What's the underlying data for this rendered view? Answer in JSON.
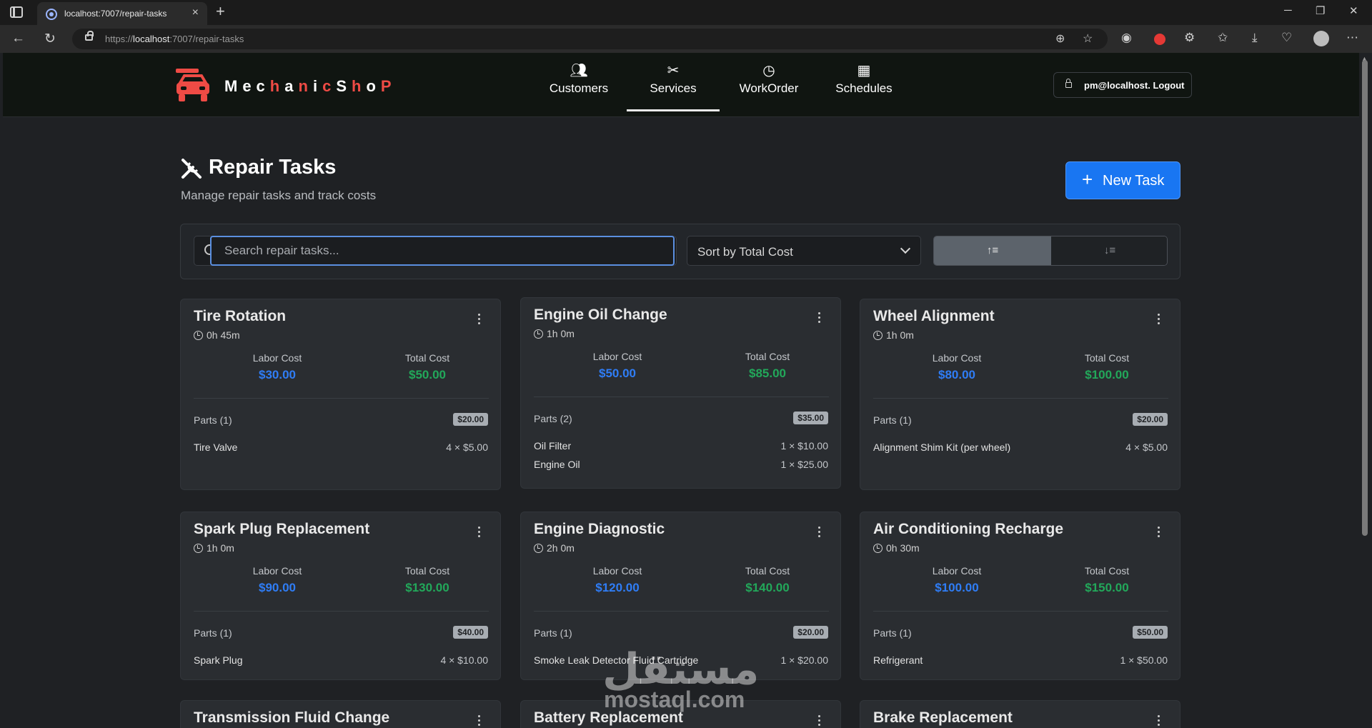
{
  "browser": {
    "tab_title": "localhost:7007/repair-tasks",
    "url_prefix": "https://",
    "url_host": "localhost",
    "url_path": ":7007/repair-tasks"
  },
  "app": {
    "brand_parts": [
      "Mec",
      "h",
      "a",
      "n",
      "i",
      "c",
      "S",
      "h",
      "o",
      "P"
    ],
    "nav": [
      {
        "label": "Customers",
        "icon": "users-icon"
      },
      {
        "label": "Services",
        "icon": "tools-icon"
      },
      {
        "label": "WorkOrder",
        "icon": "clock-icon"
      },
      {
        "label": "Schedules",
        "icon": "calendar-icon"
      }
    ],
    "active_nav": "Services",
    "user_label": "pm@localhost. Logout"
  },
  "page": {
    "title": "Repair Tasks",
    "subtitle": "Manage repair tasks and track costs",
    "new_task_label": "New Task"
  },
  "filters": {
    "search_placeholder": "Search repair tasks...",
    "search_value": "",
    "sort_value": "Sort by Total Cost",
    "asc_label": "↑≡",
    "desc_label": "↓≡"
  },
  "labels": {
    "labor": "Labor Cost",
    "total": "Total Cost"
  },
  "tasks": [
    {
      "name": "Tire Rotation",
      "duration": "0h 45m",
      "labor": "$30.00",
      "total": "$50.00",
      "parts_label": "Parts (1)",
      "parts_total": "$20.00",
      "parts": [
        {
          "name": "Tire Valve",
          "qty": "4 × $5.00"
        }
      ]
    },
    {
      "name": "Engine Oil Change",
      "duration": "1h 0m",
      "labor": "$50.00",
      "total": "$85.00",
      "parts_label": "Parts (2)",
      "parts_total": "$35.00",
      "parts": [
        {
          "name": "Oil Filter",
          "qty": "1 × $10.00"
        },
        {
          "name": "Engine Oil",
          "qty": "1 × $25.00"
        }
      ]
    },
    {
      "name": "Wheel Alignment",
      "duration": "1h 0m",
      "labor": "$80.00",
      "total": "$100.00",
      "parts_label": "Parts (1)",
      "parts_total": "$20.00",
      "parts": [
        {
          "name": "Alignment Shim Kit (per wheel)",
          "qty": "4 × $5.00"
        }
      ]
    },
    {
      "name": "Spark Plug Replacement",
      "duration": "1h 0m",
      "labor": "$90.00",
      "total": "$130.00",
      "parts_label": "Parts (1)",
      "parts_total": "$40.00",
      "parts": [
        {
          "name": "Spark Plug",
          "qty": "4 × $10.00"
        }
      ]
    },
    {
      "name": "Engine Diagnostic",
      "duration": "2h 0m",
      "labor": "$120.00",
      "total": "$140.00",
      "parts_label": "Parts (1)",
      "parts_total": "$20.00",
      "parts": [
        {
          "name": "Smoke Leak Detector Fluid Cartridge",
          "qty": "1 × $20.00"
        }
      ]
    },
    {
      "name": "Air Conditioning Recharge",
      "duration": "0h 30m",
      "labor": "$100.00",
      "total": "$150.00",
      "parts_label": "Parts (1)",
      "parts_total": "$50.00",
      "parts": [
        {
          "name": "Refrigerant",
          "qty": "1 × $50.00"
        }
      ]
    },
    {
      "name": "Transmission Fluid Change"
    },
    {
      "name": "Battery Replacement"
    },
    {
      "name": "Brake Replacement"
    }
  ],
  "watermark": {
    "arabic": "مستقل",
    "latin": "mostaql.com"
  },
  "colors": {
    "labor": "#2f7df6",
    "total": "#22a85a",
    "primary": "#1976f2",
    "brand_red": "#ef4b45"
  }
}
